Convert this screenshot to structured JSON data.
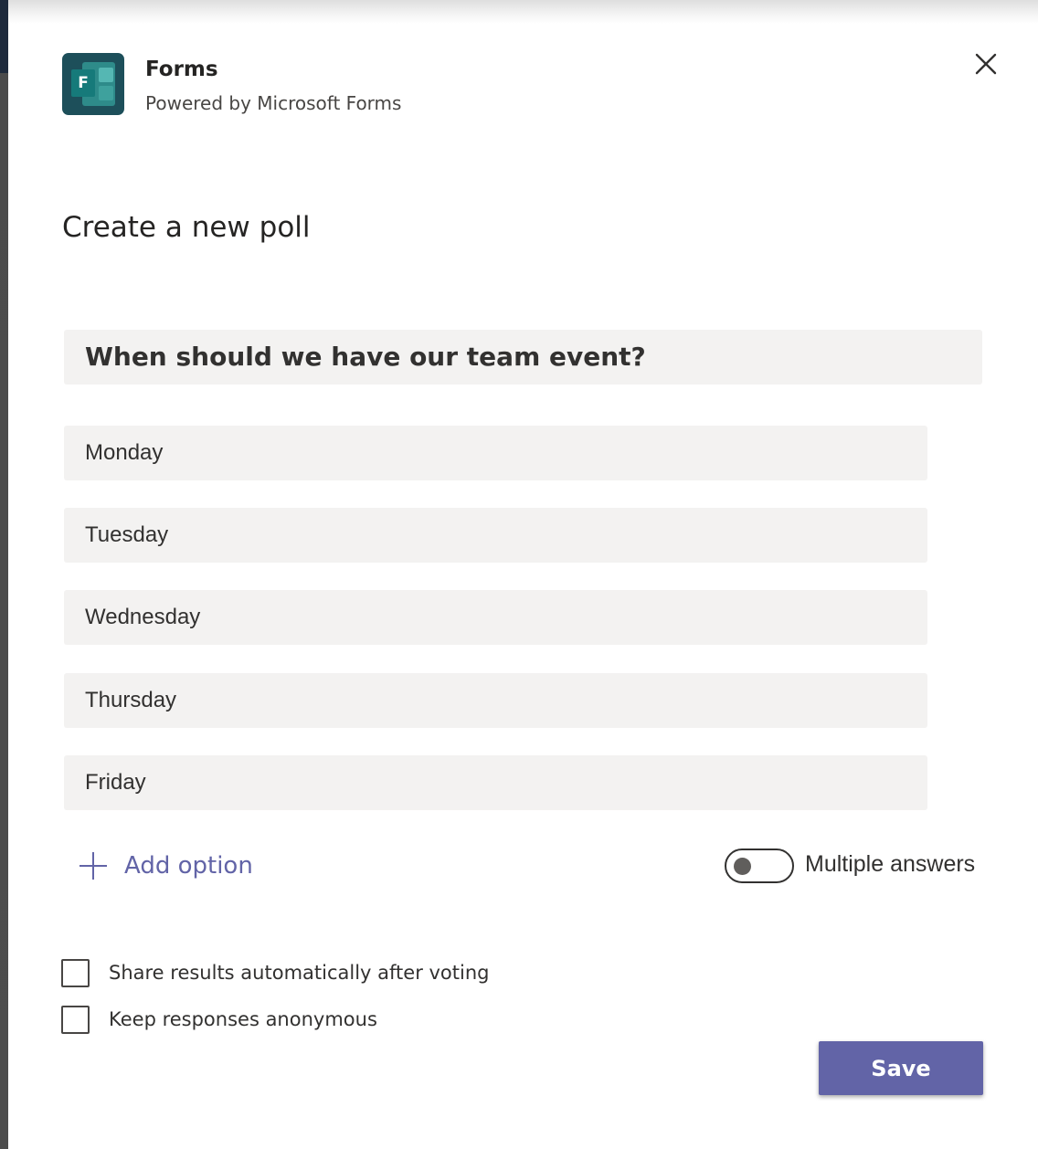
{
  "app": {
    "name": "Forms",
    "subtitle": "Powered by Microsoft Forms",
    "icon": "microsoft-forms-icon",
    "icon_letter": "F"
  },
  "close": {
    "icon": "close-icon"
  },
  "heading": "Create a new poll",
  "poll": {
    "question": "When should we have our team event?",
    "options": [
      "Monday",
      "Tuesday",
      "Wednesday",
      "Thursday",
      "Friday"
    ],
    "add_option_label": "Add option",
    "multiple_answers_label": "Multiple answers",
    "multiple_answers_on": false
  },
  "settings": [
    {
      "label": "Share results automatically after voting",
      "checked": false
    },
    {
      "label": "Keep responses anonymous",
      "checked": false
    }
  ],
  "save_label": "Save",
  "colors": {
    "accent": "#6264a7",
    "field_bg": "#f3f2f1",
    "text": "#252423"
  }
}
